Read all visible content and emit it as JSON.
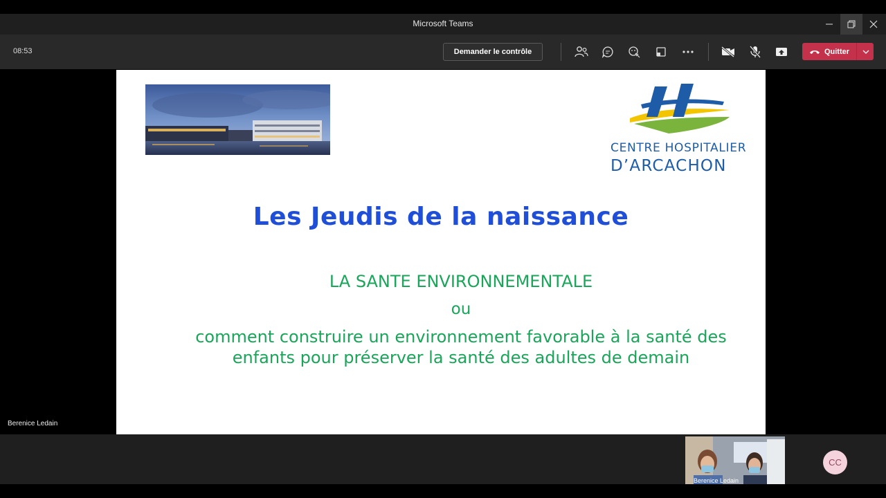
{
  "window": {
    "title": "Microsoft Teams"
  },
  "toolbar": {
    "time": "08:53",
    "request_control": "Demander le contrôle",
    "quit_label": "Quitter",
    "icons": [
      "people-icon",
      "chat-icon",
      "reactions-icon",
      "share-tray-icon",
      "more-icon",
      "camera-off-icon",
      "mic-off-icon",
      "share-screen-icon"
    ]
  },
  "slide": {
    "logo_line1": "CENTRE HOSPITALIER",
    "logo_line2": "D’ARCACHON",
    "title": "Les Jeudis de la naissance",
    "subtitle": "LA SANTE ENVIRONNEMENTALE",
    "connector": "ou",
    "line1": "comment construire un environnement favorable à la santé des",
    "line2": "enfants pour préserver la santé des adultes de demain"
  },
  "presenter": {
    "name": "Berenice Ledain"
  },
  "participants": {
    "video_label": "Berenice Ledain",
    "avatar_initials": "CC"
  },
  "colors": {
    "accent_red": "#c4314b",
    "slide_title_blue": "#1f4fd8",
    "slide_green": "#1aa55a",
    "logo_blue": "#1e5ca8"
  }
}
